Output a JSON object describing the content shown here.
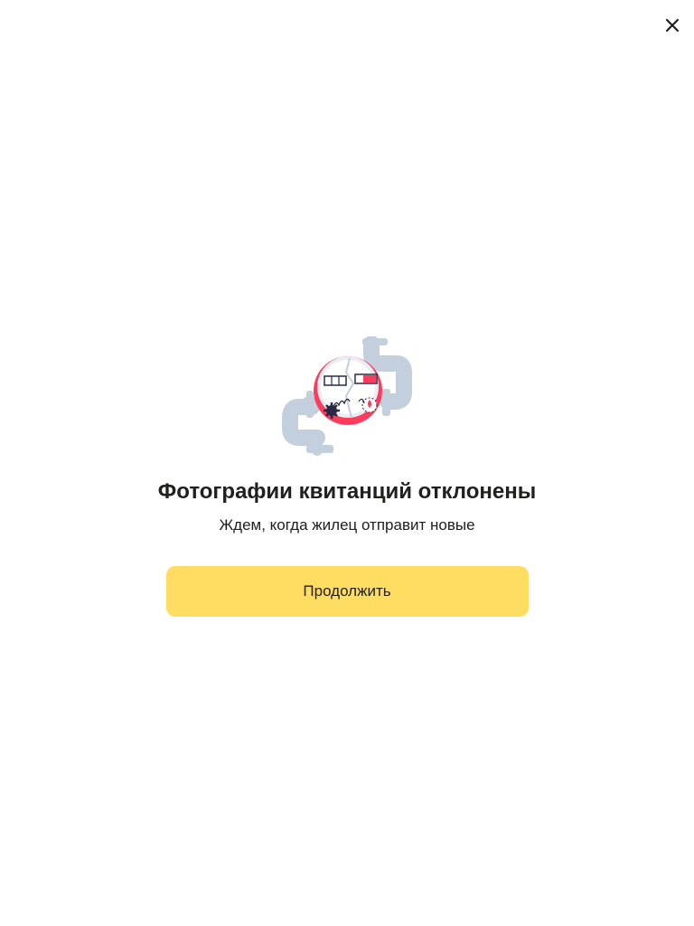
{
  "header": {
    "close_icon": "close-icon"
  },
  "illustration": {
    "icon": "water-meter-pipes-illustration",
    "colors": {
      "pipe": "#c3cfdc",
      "accent": "#ff3b5c",
      "dark": "#2b2a45"
    }
  },
  "message": {
    "title": "Фотографии квитанций отклонены",
    "subtitle": "Ждем, когда жилец отправит новые"
  },
  "actions": {
    "continue_label": "Продолжить",
    "continue_color": "#ffdd60"
  }
}
